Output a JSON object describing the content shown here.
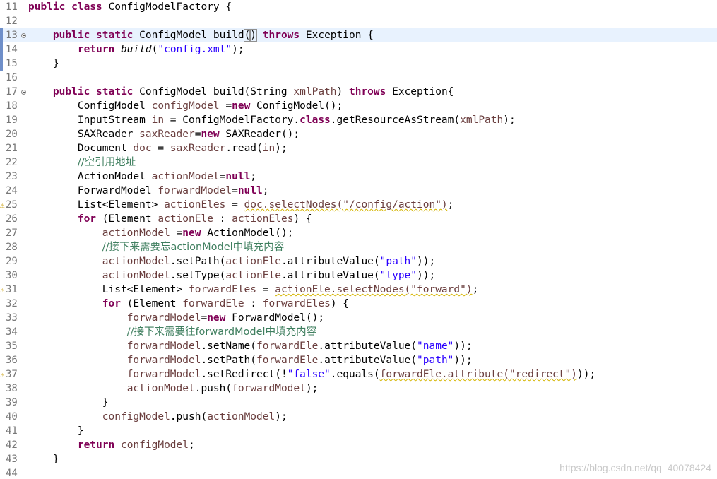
{
  "editor": {
    "lines": [
      {
        "num": "11",
        "tokens": [
          {
            "k": "kw",
            "t": "public class"
          },
          {
            "t": " ConfigModelFactory {"
          }
        ]
      },
      {
        "num": "12",
        "tokens": []
      },
      {
        "num": "13",
        "fold": true,
        "current": true,
        "change": true,
        "tokens": [
          {
            "t": "    "
          },
          {
            "k": "kw",
            "t": "public static"
          },
          {
            "t": " ConfigModel build"
          },
          {
            "k": "bx",
            "t": "("
          },
          {
            "k": "caret",
            "t": ""
          },
          {
            "k": "bx",
            "t": ")"
          },
          {
            "t": " "
          },
          {
            "k": "kw",
            "t": "throws"
          },
          {
            "t": " Exception {"
          }
        ]
      },
      {
        "num": "14",
        "change": true,
        "tokens": [
          {
            "t": "        "
          },
          {
            "k": "kw",
            "t": "return"
          },
          {
            "t": " "
          },
          {
            "k": "it",
            "t": "build"
          },
          {
            "t": "("
          },
          {
            "k": "s",
            "t": "\"config.xml\""
          },
          {
            "t": ");"
          }
        ]
      },
      {
        "num": "15",
        "change": true,
        "tokens": [
          {
            "t": "    }"
          }
        ]
      },
      {
        "num": "16",
        "tokens": []
      },
      {
        "num": "17",
        "fold": true,
        "tokens": [
          {
            "t": "    "
          },
          {
            "k": "kw",
            "t": "public static"
          },
          {
            "t": " ConfigModel build(String "
          },
          {
            "k": "v",
            "t": "xmlPath"
          },
          {
            "t": ") "
          },
          {
            "k": "kw",
            "t": "throws"
          },
          {
            "t": " Exception{"
          }
        ]
      },
      {
        "num": "18",
        "tokens": [
          {
            "t": "        ConfigModel "
          },
          {
            "k": "v",
            "t": "configModel"
          },
          {
            "t": " ="
          },
          {
            "k": "kw",
            "t": "new"
          },
          {
            "t": " ConfigModel();"
          }
        ]
      },
      {
        "num": "19",
        "tokens": [
          {
            "t": "        InputStream "
          },
          {
            "k": "v",
            "t": "in"
          },
          {
            "t": " = ConfigModelFactory."
          },
          {
            "k": "kw",
            "t": "class"
          },
          {
            "t": ".getResourceAsStream("
          },
          {
            "k": "v",
            "t": "xmlPath"
          },
          {
            "t": ");"
          }
        ]
      },
      {
        "num": "20",
        "tokens": [
          {
            "t": "        SAXReader "
          },
          {
            "k": "v",
            "t": "saxReader"
          },
          {
            "t": "="
          },
          {
            "k": "kw",
            "t": "new"
          },
          {
            "t": " SAXReader();"
          }
        ]
      },
      {
        "num": "21",
        "tokens": [
          {
            "t": "        Document "
          },
          {
            "k": "v",
            "t": "doc"
          },
          {
            "t": " = "
          },
          {
            "k": "v",
            "t": "saxReader"
          },
          {
            "t": ".read("
          },
          {
            "k": "v",
            "t": "in"
          },
          {
            "t": ");"
          }
        ]
      },
      {
        "num": "22",
        "tokens": [
          {
            "t": "        "
          },
          {
            "k": "c",
            "t": "//空引用地址"
          }
        ]
      },
      {
        "num": "23",
        "tokens": [
          {
            "t": "        ActionModel "
          },
          {
            "k": "v",
            "t": "actionModel"
          },
          {
            "t": "="
          },
          {
            "k": "kw",
            "t": "null"
          },
          {
            "t": ";"
          }
        ]
      },
      {
        "num": "24",
        "tokens": [
          {
            "t": "        ForwardModel "
          },
          {
            "k": "v",
            "t": "forwardModel"
          },
          {
            "t": "="
          },
          {
            "k": "kw",
            "t": "null"
          },
          {
            "t": ";"
          }
        ]
      },
      {
        "num": "25",
        "warn": true,
        "tokens": [
          {
            "t": "        List<Element> "
          },
          {
            "k": "v",
            "t": "actionEles"
          },
          {
            "t": " = "
          },
          {
            "k": "vsq",
            "t": "doc.selectNodes(\"/config/action\")"
          },
          {
            "t": ";"
          }
        ]
      },
      {
        "num": "26",
        "tokens": [
          {
            "t": "        "
          },
          {
            "k": "kw",
            "t": "for"
          },
          {
            "t": " (Element "
          },
          {
            "k": "v",
            "t": "actionEle"
          },
          {
            "t": " : "
          },
          {
            "k": "v",
            "t": "actionEles"
          },
          {
            "t": ") {"
          }
        ]
      },
      {
        "num": "27",
        "tokens": [
          {
            "t": "            "
          },
          {
            "k": "v",
            "t": "actionModel"
          },
          {
            "t": " ="
          },
          {
            "k": "kw",
            "t": "new"
          },
          {
            "t": " ActionModel();"
          }
        ]
      },
      {
        "num": "28",
        "tokens": [
          {
            "t": "            "
          },
          {
            "k": "c",
            "t": "//接下来需要忘actionModel中填充内容"
          }
        ]
      },
      {
        "num": "29",
        "tokens": [
          {
            "t": "            "
          },
          {
            "k": "v",
            "t": "actionModel"
          },
          {
            "t": ".setPath("
          },
          {
            "k": "v",
            "t": "actionEle"
          },
          {
            "t": ".attributeValue("
          },
          {
            "k": "s",
            "t": "\"path\""
          },
          {
            "t": "));"
          }
        ]
      },
      {
        "num": "30",
        "tokens": [
          {
            "t": "            "
          },
          {
            "k": "v",
            "t": "actionModel"
          },
          {
            "t": ".setType("
          },
          {
            "k": "v",
            "t": "actionEle"
          },
          {
            "t": ".attributeValue("
          },
          {
            "k": "s",
            "t": "\"type\""
          },
          {
            "t": "));"
          }
        ]
      },
      {
        "num": "31",
        "warn": true,
        "tokens": [
          {
            "t": "            List<Element> "
          },
          {
            "k": "v",
            "t": "forwardEles"
          },
          {
            "t": " = "
          },
          {
            "k": "vsq",
            "t": "actionEle.selectNodes(\"forward\")"
          },
          {
            "t": ";"
          }
        ]
      },
      {
        "num": "32",
        "tokens": [
          {
            "t": "            "
          },
          {
            "k": "kw",
            "t": "for"
          },
          {
            "t": " (Element "
          },
          {
            "k": "v",
            "t": "forwardEle"
          },
          {
            "t": " : "
          },
          {
            "k": "v",
            "t": "forwardEles"
          },
          {
            "t": ") {"
          }
        ]
      },
      {
        "num": "33",
        "tokens": [
          {
            "t": "                "
          },
          {
            "k": "v",
            "t": "forwardModel"
          },
          {
            "t": "="
          },
          {
            "k": "kw",
            "t": "new"
          },
          {
            "t": " ForwardModel();"
          }
        ]
      },
      {
        "num": "34",
        "tokens": [
          {
            "t": "                "
          },
          {
            "k": "c",
            "t": "//接下来需要往forwardModel中填充内容"
          }
        ]
      },
      {
        "num": "35",
        "tokens": [
          {
            "t": "                "
          },
          {
            "k": "v",
            "t": "forwardModel"
          },
          {
            "t": ".setName("
          },
          {
            "k": "v",
            "t": "forwardEle"
          },
          {
            "t": ".attributeValue("
          },
          {
            "k": "s",
            "t": "\"name\""
          },
          {
            "t": "));"
          }
        ]
      },
      {
        "num": "36",
        "tokens": [
          {
            "t": "                "
          },
          {
            "k": "v",
            "t": "forwardModel"
          },
          {
            "t": ".setPath("
          },
          {
            "k": "v",
            "t": "forwardEle"
          },
          {
            "t": ".attributeValue("
          },
          {
            "k": "s",
            "t": "\"path\""
          },
          {
            "t": "));"
          }
        ]
      },
      {
        "num": "37",
        "warn": true,
        "tokens": [
          {
            "t": "                "
          },
          {
            "k": "v",
            "t": "forwardModel"
          },
          {
            "t": ".setRedirect(!"
          },
          {
            "k": "s",
            "t": "\"false\""
          },
          {
            "t": ".equals("
          },
          {
            "k": "vsq",
            "t": "forwardEle.attribute(\"redirect\")"
          },
          {
            "t": "));"
          }
        ]
      },
      {
        "num": "38",
        "tokens": [
          {
            "t": "                "
          },
          {
            "k": "v",
            "t": "actionModel"
          },
          {
            "t": ".push("
          },
          {
            "k": "v",
            "t": "forwardModel"
          },
          {
            "t": ");"
          }
        ]
      },
      {
        "num": "39",
        "tokens": [
          {
            "t": "            }"
          }
        ]
      },
      {
        "num": "40",
        "tokens": [
          {
            "t": "            "
          },
          {
            "k": "v",
            "t": "configModel"
          },
          {
            "t": ".push("
          },
          {
            "k": "v",
            "t": "actionModel"
          },
          {
            "t": ");"
          }
        ]
      },
      {
        "num": "41",
        "tokens": [
          {
            "t": "        }"
          }
        ]
      },
      {
        "num": "42",
        "tokens": [
          {
            "t": "        "
          },
          {
            "k": "kw",
            "t": "return"
          },
          {
            "t": " "
          },
          {
            "k": "v",
            "t": "configModel"
          },
          {
            "t": ";"
          }
        ]
      },
      {
        "num": "43",
        "tokens": [
          {
            "t": "    }"
          }
        ]
      },
      {
        "num": "44",
        "tokens": []
      }
    ]
  },
  "watermark": "https://blog.csdn.net/qq_40078424",
  "colors": {
    "keyword": "#7f0055",
    "variable": "#6a3e3e",
    "string": "#2a00ff",
    "comment": "#3f7f5f",
    "current_line": "#e8f2fe"
  }
}
